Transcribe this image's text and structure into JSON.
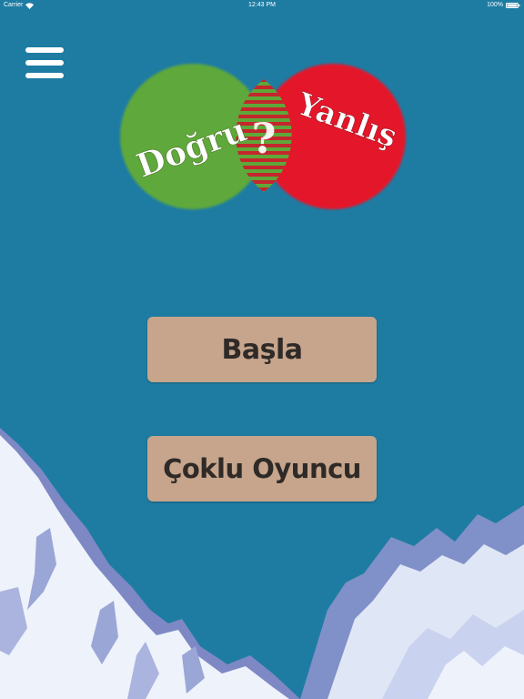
{
  "status_bar": {
    "carrier": "Carrier",
    "time": "12:43 PM",
    "battery": "100%"
  },
  "logo": {
    "left_word": "Doğru",
    "right_word": "Yanlış",
    "center_symbol": "?",
    "left_color": "#5ea83a",
    "right_color": "#e4182b"
  },
  "menu": {
    "icon": "hamburger-menu-icon"
  },
  "buttons": {
    "start_label": "Başla",
    "multiplayer_label": "Çoklu Oyuncu",
    "color": "#c6a58c"
  },
  "colors": {
    "background": "#1e7ca3",
    "text_dark": "#2f2a27"
  }
}
